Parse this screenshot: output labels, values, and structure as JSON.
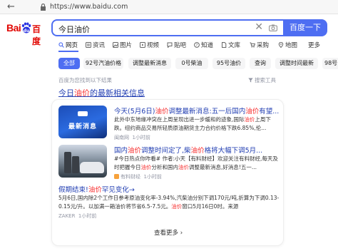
{
  "browser": {
    "url": "https://www.baidu.com"
  },
  "logo": {
    "part1": "Bai",
    "part2": "百度"
  },
  "search": {
    "query": "今日油价",
    "clear_glyph": "✕",
    "button_label": "百度一下"
  },
  "tabs": [
    {
      "label": "网页",
      "icon": "search-icon",
      "active": true
    },
    {
      "label": "资讯",
      "icon": "news-icon"
    },
    {
      "label": "图片",
      "icon": "image-icon"
    },
    {
      "label": "视频",
      "icon": "video-icon"
    },
    {
      "label": "贴吧",
      "icon": "tieba-icon"
    },
    {
      "label": "知道",
      "icon": "zhidao-icon"
    },
    {
      "label": "文库",
      "icon": "wenku-icon"
    },
    {
      "label": "采购",
      "icon": "cart-icon"
    },
    {
      "label": "地图",
      "icon": "map-icon"
    },
    {
      "label": "更多"
    }
  ],
  "chips": [
    "全部",
    "92号汽油价格",
    "调整最新消息",
    "0号柴油",
    "95号油价",
    "查询",
    "调整时间最新",
    "98号"
  ],
  "results_info": {
    "found": "百度为您找到以下结果",
    "tools": "搜索工具"
  },
  "section": {
    "title_prefix": "今日",
    "title_highlight": "油价",
    "title_suffix": "的最新相关信息"
  },
  "news": [
    {
      "thumb_text": "最新消息",
      "title_a": "今天(5月6日)",
      "title_b": "油价",
      "title_c": "调整最新消息:五一后国内",
      "title_d": "油价",
      "title_e": "有望...",
      "line1": "此外中东地缘冲突在上周呈现出进一步缓和的迹象,国际",
      "line1_hl": "油价",
      "line1_end": "上周下",
      "line2": "跌。纽约商品交易所轻质原油期货主力合约价格下跌6.85%,伦...",
      "source": "闽南网",
      "time": "1小时前"
    },
    {
      "title_a": "国内",
      "title_b": "油价",
      "title_c": "调整时间定了,柴",
      "title_d": "油价",
      "title_e": "格将大幅下调5月...",
      "line1": "#今日热点你咋看# 作者:小天【有料财经】欢迎关注有料财经,每天及",
      "line2a": "时把握今日",
      "line2_hl": "油价",
      "line2b": "分析和国内",
      "line2_hl2": "油价",
      "line2c": "调整最新消息,好消息!五一...",
      "source": "有料财经",
      "time": "1小时前"
    },
    {
      "title_a": "假期结束!",
      "title_b": "油价",
      "title_c": "罕见变化→",
      "line1": "5月6日,国内除2个工作日参考原油变化率-3.94%,汽柴油分别下调170元/吨,折算为下调0.13-",
      "line2": "0.15元/升。以加满一箱油价将节省6.5-7.5元。",
      "line2_hl": "油价",
      "line2b": "窗口5月16日0时。来源",
      "source": "ZAKER",
      "time": "1小时前"
    }
  ],
  "more_label": "查看更多 ›",
  "colors": {
    "brand_blue": "#4e6ef2",
    "link_blue": "#2440b3",
    "highlight_red": "#f73131",
    "logo_red": "#e10602"
  }
}
